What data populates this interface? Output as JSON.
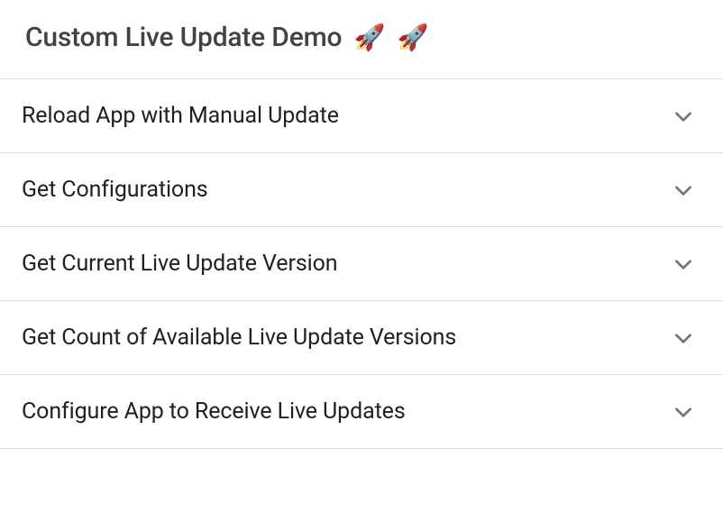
{
  "header": {
    "title": "Custom Live Update Demo",
    "emoji": "🚀",
    "emoji_count": 2
  },
  "items": [
    {
      "label": "Reload App with Manual Update"
    },
    {
      "label": "Get Configurations"
    },
    {
      "label": "Get Current Live Update Version"
    },
    {
      "label": "Get Count of Available Live Update Versions"
    },
    {
      "label": "Configure App to Receive Live Updates"
    }
  ]
}
